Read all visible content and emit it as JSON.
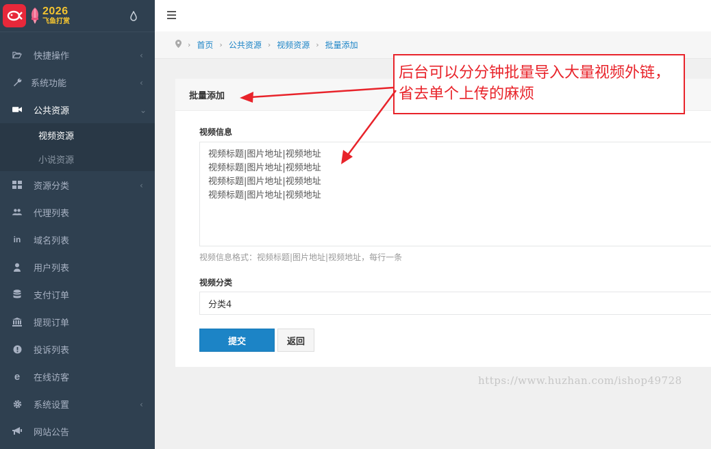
{
  "brand": {
    "year": "2026",
    "name": "飞鱼打赏"
  },
  "sidebar": {
    "items": [
      {
        "label": "快捷操作",
        "icon": "folder-open-icon",
        "has_arrow": true
      },
      {
        "label": "系统功能",
        "icon": "wrench-icon",
        "has_arrow": true
      },
      {
        "label": "公共资源",
        "icon": "video-camera-icon",
        "has_arrow": true,
        "expanded": true
      },
      {
        "label": "资源分类",
        "icon": "grid-icon",
        "has_arrow": true
      },
      {
        "label": "代理列表",
        "icon": "users-icon",
        "has_arrow": false
      },
      {
        "label": "域名列表",
        "icon": "linkedin-icon",
        "has_arrow": false
      },
      {
        "label": "用户列表",
        "icon": "user-icon",
        "has_arrow": false
      },
      {
        "label": "支付订单",
        "icon": "database-icon",
        "has_arrow": false
      },
      {
        "label": "提现订单",
        "icon": "bank-icon",
        "has_arrow": false
      },
      {
        "label": "投诉列表",
        "icon": "exclamation-circle-icon",
        "has_arrow": false
      },
      {
        "label": "在线访客",
        "icon": "ie-icon",
        "has_arrow": false
      },
      {
        "label": "系统设置",
        "icon": "gear-icon",
        "has_arrow": true
      },
      {
        "label": "网站公告",
        "icon": "bullhorn-icon",
        "has_arrow": false
      }
    ],
    "submenu": [
      {
        "label": "视频资源",
        "current": true
      },
      {
        "label": "小说资源",
        "current": false
      }
    ]
  },
  "breadcrumb": [
    "首页",
    "公共资源",
    "视频资源",
    "批量添加"
  ],
  "panel": {
    "title": "批量添加",
    "video_info_label": "视频信息",
    "video_info_value": "视频标题|图片地址|视频地址\n视频标题|图片地址|视频地址\n视频标题|图片地址|视频地址\n视频标题|图片地址|视频地址",
    "help_text": "视频信息格式：视频标题|图片地址|视频地址，每行一条",
    "category_label": "视频分类",
    "category_value": "分类4",
    "submit_label": "提交",
    "back_label": "返回"
  },
  "annotation": {
    "line1": "后台可以分分钟批量导入大量视频外链，",
    "line2": "省去单个上传的麻烦",
    "color": "#e8232a"
  },
  "watermark": "https://www.huzhan.com/ishop49728",
  "colors": {
    "sidebar_bg": "#2f4050",
    "accent": "#1c84c6",
    "brand_red": "#e8283a"
  }
}
